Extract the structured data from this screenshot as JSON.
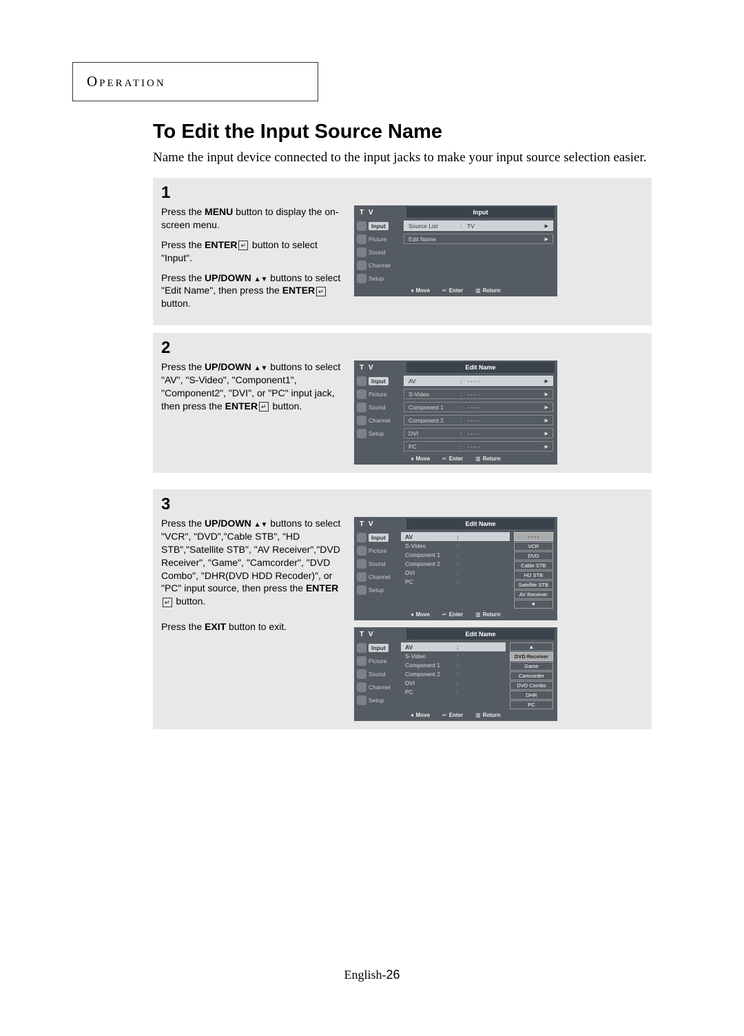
{
  "section_label": "Operation",
  "page_title": "To Edit the Input Source Name",
  "intro": "Name the input device connected to the input jacks to make your input source selection easier.",
  "steps": {
    "s1": {
      "num": "1",
      "p1a": "Press the ",
      "p1b": "MENU",
      "p1c": " button to display the on-screen menu.",
      "p2a": "Press the ",
      "p2b": "ENTER",
      "p2c": " button to select \"Input\".",
      "p3a": "Press the ",
      "p3b": "UP/DOWN",
      "p3c": " buttons to select \"Edit Name\", then press the ",
      "p3d": "ENTER",
      "p3e": " button."
    },
    "s2": {
      "num": "2",
      "p1a": "Press the ",
      "p1b": "UP/DOWN",
      "p1c": " buttons to select \"AV\", \"S-Video\", \"Component1\", \"Component2\", \"DVI\", or \"PC\" input jack, then press the ",
      "p1d": "ENTER",
      "p1e": " button."
    },
    "s3": {
      "num": "3",
      "p1a": "Press the ",
      "p1b": "UP/DOWN",
      "p1c": " buttons to select \"VCR\", \"DVD\",\"Cable STB\", \"HD STB\",\"Satellite STB\", \"AV Receiver\",\"DVD Receiver\", \"Game\", \"Camcorder\", \"DVD Combo\", \"DHR(DVD HDD Recoder)\", or \"PC\" input source, then press the ",
      "p1d": "ENTER",
      "p1e": " button.",
      "p2a": "Press the ",
      "p2b": "EXIT",
      "p2c": " button to exit."
    }
  },
  "osd": {
    "tv": "T V",
    "sidebar": [
      "Input",
      "Picture",
      "Sound",
      "Channel",
      "Setup"
    ],
    "footer": {
      "move": "Move",
      "enter": "Enter",
      "return": "Return"
    },
    "screen1": {
      "title": "Input",
      "rows": [
        {
          "label": "Source List",
          "val": "TV",
          "hl": true
        },
        {
          "label": "Edit Name",
          "val": "",
          "hl": false
        }
      ]
    },
    "screen2": {
      "title": "Edit Name",
      "rows": [
        {
          "label": "AV",
          "val": "- - - -",
          "hl": true
        },
        {
          "label": "S-Video",
          "val": "- - - -"
        },
        {
          "label": "Component 1",
          "val": "- - - -"
        },
        {
          "label": "Component 2",
          "val": "- - - -"
        },
        {
          "label": "DVI",
          "val": "- - - -"
        },
        {
          "label": "PC",
          "val": "- - - -"
        }
      ]
    },
    "screen3a": {
      "title": "Edit Name",
      "rows": [
        {
          "label": "AV"
        },
        {
          "label": "S-Video"
        },
        {
          "label": "Component 1"
        },
        {
          "label": "Component 2"
        },
        {
          "label": "DVI"
        },
        {
          "label": "PC"
        }
      ],
      "options": [
        "- - - -",
        "VCR",
        "DVD",
        "Cable STB",
        "HD STB",
        "Satellite STB",
        "AV Receiver",
        "▼"
      ],
      "hl_idx": 0
    },
    "screen3b": {
      "title": "Edit Name",
      "rows": [
        {
          "label": "AV"
        },
        {
          "label": "S-Video"
        },
        {
          "label": "Component 1"
        },
        {
          "label": "Component 2"
        },
        {
          "label": "DVI"
        },
        {
          "label": "PC"
        }
      ],
      "options": [
        "▲",
        "DVD Receiver",
        "Game",
        "Camcorder",
        "DVD Combo",
        "DHR",
        "PC"
      ],
      "hl_idx": 1
    }
  },
  "page_footer_lang": "English-",
  "page_footer_num": "26"
}
